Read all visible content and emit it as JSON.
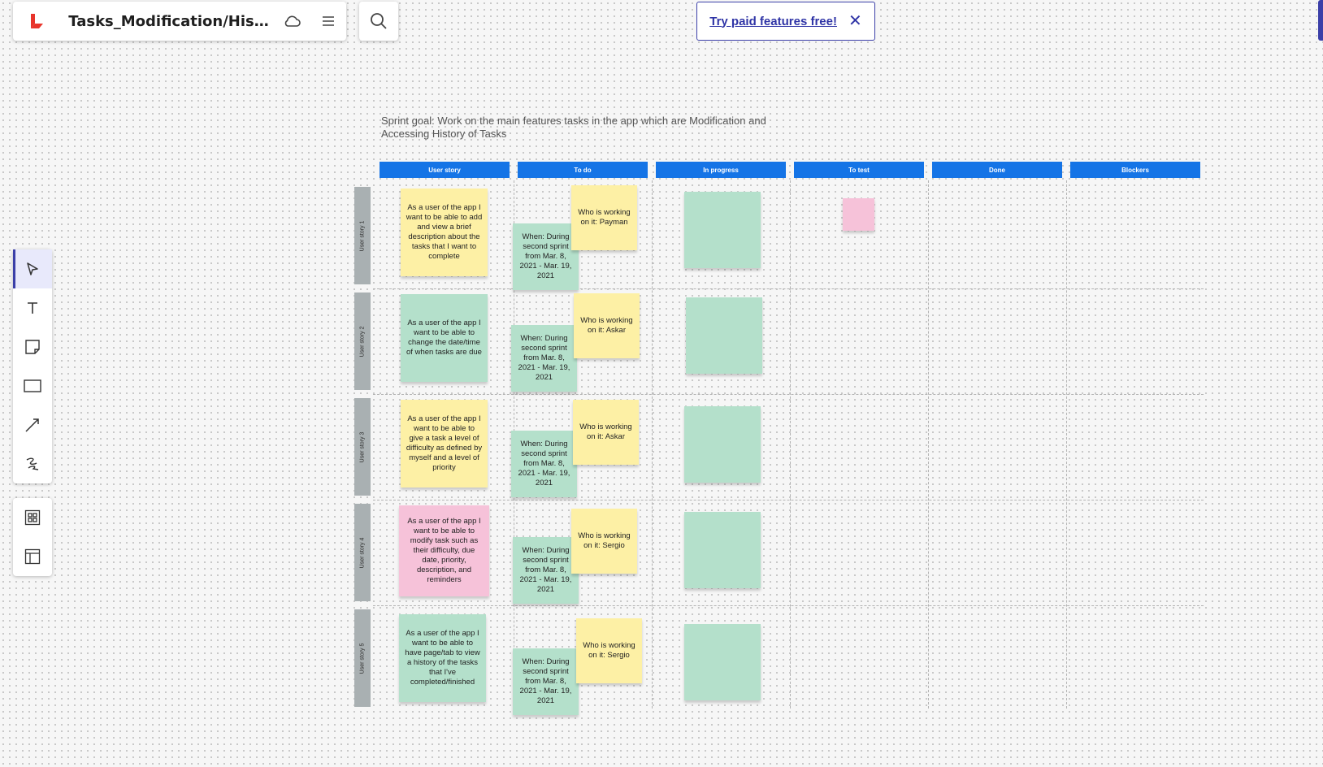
{
  "app": {
    "title": "Tasks_Modification/Hist..."
  },
  "promo": {
    "link_label": "Try paid features free!",
    "close_glyph": "✕"
  },
  "toolbar": {
    "tools": [
      "select-icon",
      "text-icon",
      "sticky-note-icon",
      "rectangle-icon",
      "line-icon",
      "pen-icon"
    ],
    "extra": [
      "templates-icon",
      "frame-icon"
    ]
  },
  "board": {
    "sprint_goal": "Sprint goal: Work on the main features tasks in the app which are Modification and Accessing History of Tasks",
    "columns": [
      "User story",
      "To do",
      "In progress",
      "To test",
      "Done",
      "Blockers"
    ],
    "column_color": "#1574e6",
    "rows": [
      {
        "label": "User story 1",
        "story": "As a user of the app I want to be able to add and view a brief description about the tasks that I want to complete",
        "story_color": "yellow",
        "when": "When: During second sprint from Mar. 8, 2021 - Mar. 19, 2021",
        "who": "Who is working on it: Payman"
      },
      {
        "label": "User story 2",
        "story": "As a user of the app I want to be able to change the date/time of when tasks are due",
        "story_color": "green",
        "when": "When: During second sprint from Mar. 8, 2021 - Mar. 19, 2021",
        "who": "Who is working on it: Askar"
      },
      {
        "label": "User story 3",
        "story": "As a user of the app I want to be able to give a task a level of difficulty as defined by myself and a level of priority",
        "story_color": "yellow",
        "when": "When: During second sprint from Mar. 8, 2021 - Mar. 19, 2021",
        "who": "Who is working on it: Askar"
      },
      {
        "label": "User story 4",
        "story": "As a user of the app I want to be able to modify task such as their difficulty, due date, priority, description, and reminders",
        "story_color": "pink",
        "when": "When: During second sprint from Mar. 8, 2021 - Mar. 19, 2021",
        "who": "Who is working on it: Sergio"
      },
      {
        "label": "User story 5",
        "story": "As a user of the app I want to be able to have page/tab to view a history of the tasks that I've completed/finished",
        "story_color": "green",
        "when": "When: During second sprint from Mar. 8, 2021 - Mar. 19, 2021",
        "who": "Who is working on it: Sergio"
      }
    ],
    "note_colors": {
      "yellow": "#fdf0a5",
      "green": "#b4e0cb",
      "pink": "#f6c2d9"
    }
  }
}
